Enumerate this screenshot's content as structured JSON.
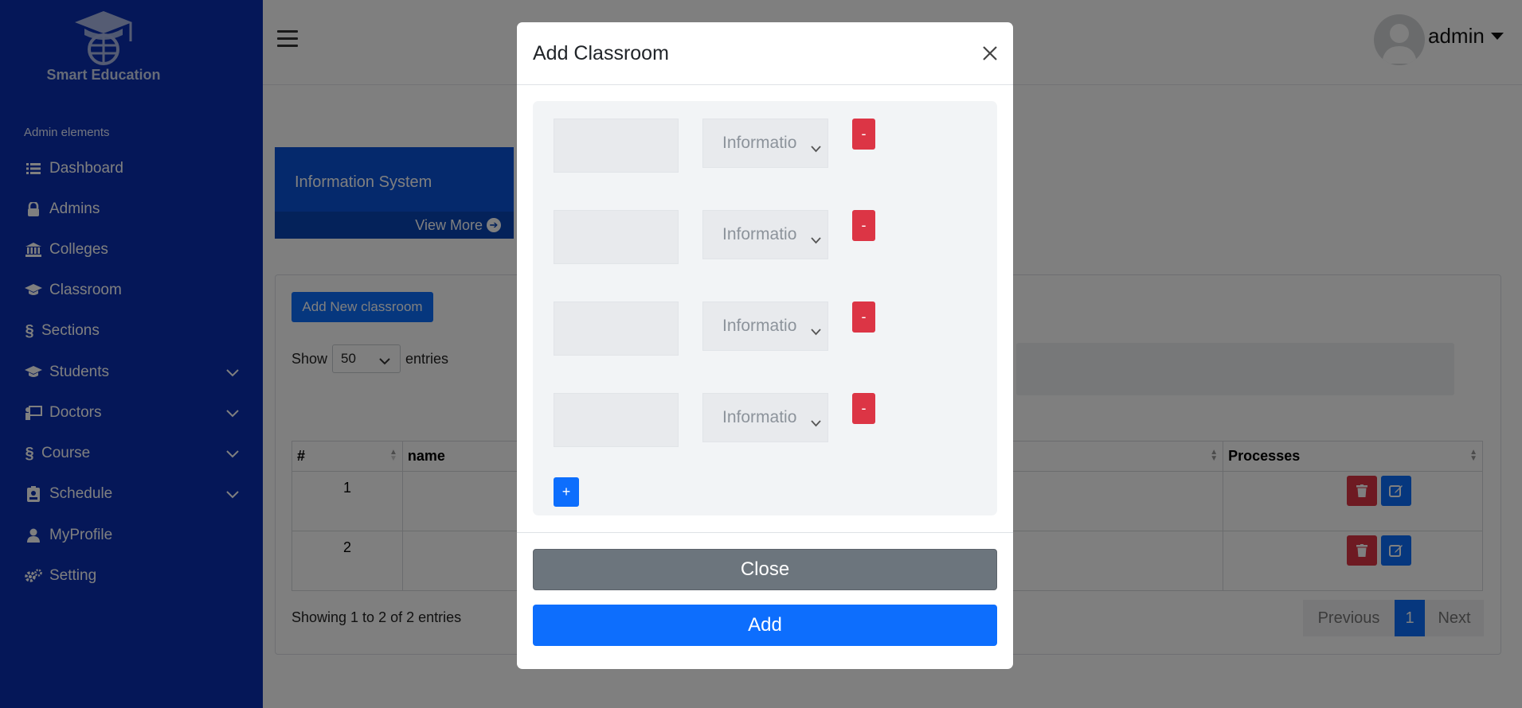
{
  "brand": {
    "name": "Smart Education"
  },
  "sidebar": {
    "heading": "Admin elements",
    "items": [
      {
        "label": "Dashboard",
        "icon": "list-icon"
      },
      {
        "label": "Admins",
        "icon": "lock-icon"
      },
      {
        "label": "Colleges",
        "icon": "institution-icon"
      },
      {
        "label": "Classroom",
        "icon": "graduation-cap-icon"
      },
      {
        "label": "Sections",
        "icon": "section-icon"
      },
      {
        "label": "Students",
        "icon": "graduation-cap-icon",
        "expandable": true
      },
      {
        "label": "Doctors",
        "icon": "teacher-icon",
        "expandable": true
      },
      {
        "label": "Course",
        "icon": "section-icon",
        "expandable": true
      },
      {
        "label": "Schedule",
        "icon": "id-badge-icon",
        "expandable": true
      },
      {
        "label": "MyProfile",
        "icon": "user-icon"
      },
      {
        "label": "Setting",
        "icon": "gears-icon"
      }
    ]
  },
  "header": {
    "user": "admin"
  },
  "info_card": {
    "title": "Information System",
    "link": "View More"
  },
  "table_panel": {
    "add_button": "Add New classroom",
    "show_label": "Show",
    "entries_value": "50",
    "entries_label": "entries",
    "columns": [
      "#",
      "name",
      "Processes"
    ],
    "rows": [
      {
        "num": "1",
        "name": ""
      },
      {
        "num": "2",
        "name": ""
      }
    ],
    "info": "Showing 1 to 2 of 2 entries",
    "pagination": {
      "previous": "Previous",
      "current": "1",
      "next": "Next"
    }
  },
  "modal": {
    "title": "Add Classroom",
    "rows": [
      {
        "name": "",
        "system": "Information System"
      },
      {
        "name": "",
        "system": "Information System"
      },
      {
        "name": "",
        "system": "Information System"
      },
      {
        "name": "",
        "system": "Information System"
      }
    ],
    "remove_label": "-",
    "add_row_label": "+",
    "close_label": "Close",
    "submit_label": "Add"
  },
  "colors": {
    "sidebar": "#0a2fb0",
    "primary": "#0d6efd",
    "danger": "#dc3545",
    "secondary": "#6c757d"
  }
}
